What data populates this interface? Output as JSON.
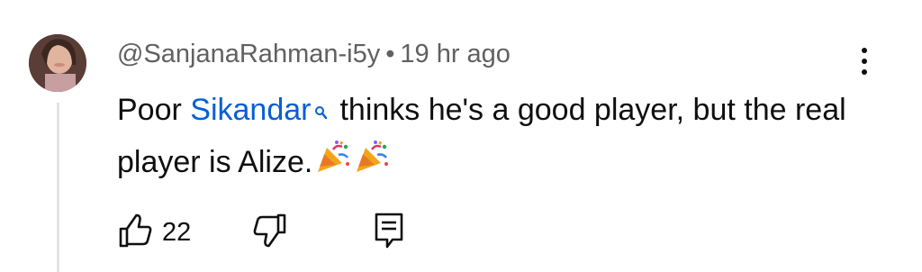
{
  "comment": {
    "author": "@SanjanaRahman-i5y",
    "separator": "•",
    "time": "19 hr ago",
    "text_before": "Poor ",
    "mention": "Sikandar",
    "text_after": "thinks he's a good player, but the real player is Alize.",
    "emojis": [
      "party-popper",
      "party-popper"
    ]
  },
  "actions": {
    "like_count": "22",
    "icons": [
      "thumbs-up-icon",
      "thumbs-down-icon",
      "reply-icon",
      "more-vert-icon"
    ]
  },
  "colors": {
    "mention": "#065fd4",
    "meta_text": "#606060",
    "text": "#0f0f0f"
  }
}
